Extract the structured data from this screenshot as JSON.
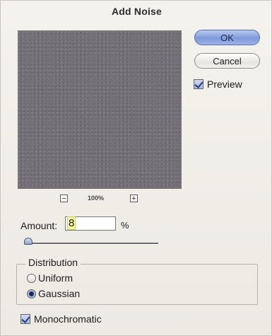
{
  "dialog": {
    "title": "Add Noise",
    "zoom_level": "100%",
    "zoom_out_icon": "minus-icon",
    "zoom_in_icon": "plus-icon",
    "buttons": {
      "ok": "OK",
      "cancel": "Cancel"
    },
    "preview": {
      "label": "Preview",
      "checked": true
    },
    "amount": {
      "label": "Amount:",
      "value": "8",
      "unit": "%",
      "slider_fraction": 0.02
    },
    "distribution": {
      "legend": "Distribution",
      "options": [
        {
          "label": "Uniform",
          "selected": false
        },
        {
          "label": "Gaussian",
          "selected": true
        }
      ]
    },
    "monochromatic": {
      "label": "Monochromatic",
      "checked": true
    },
    "colors": {
      "accent": "#7f9ada",
      "preview_noise": "#747078"
    }
  }
}
